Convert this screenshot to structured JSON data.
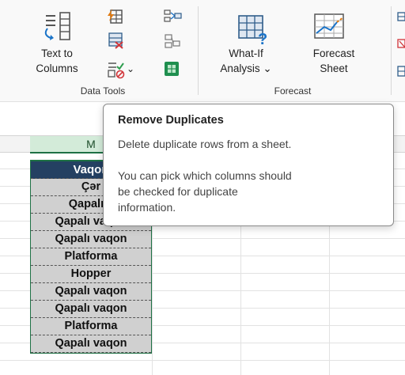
{
  "ribbon": {
    "data_tools_group": {
      "label": "Data Tools",
      "text_to_columns": {
        "line1": "Text to",
        "line2": "Columns"
      },
      "remove_duplicates_icon": "remove-duplicates-icon",
      "data_validation_dropdown": "⌄"
    },
    "forecast_group": {
      "label": "Forecast",
      "what_if": {
        "line1": "What-If",
        "line2": "Analysis ⌄"
      },
      "forecast_sheet": {
        "line1": "Forecast",
        "line2": "Sheet"
      }
    }
  },
  "sheet": {
    "column_header": "M",
    "cells": [
      "Vaqon",
      "Çər",
      "Qapalı v",
      "Qapalı vaqon",
      "Qapalı vaqon",
      "Platforma",
      "Hopper",
      "Qapalı vaqon",
      "Qapalı vaqon",
      "Platforma",
      "Qapalı vaqon"
    ]
  },
  "tooltip": {
    "title": "Remove Duplicates",
    "line1": "Delete duplicate rows from a sheet.",
    "line2": "You can pick which columns should",
    "line3": "be checked for duplicate",
    "line4": "information."
  },
  "colors": {
    "accent_green": "#1e7145",
    "header_blue": "#244062",
    "cell_gray": "#d0d0d0"
  }
}
